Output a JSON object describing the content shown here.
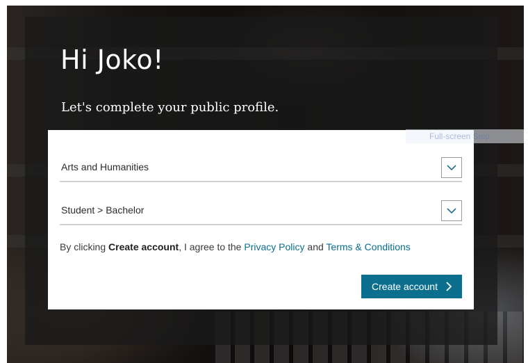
{
  "greeting": "Hi Joko!",
  "subtitle": "Let's complete your public profile.",
  "fields": {
    "subject_area": {
      "value": "Arts and Humanities",
      "icon": "chevron-down-icon"
    },
    "position": {
      "value": "Student > Bachelor",
      "icon": "chevron-down-icon"
    }
  },
  "terms": {
    "prefix": "By clicking",
    "strong": "Create account",
    "middle": ", I agree to the",
    "privacy_link": "Privacy Policy",
    "and": "and",
    "terms_link": "Terms & Conditions"
  },
  "create_button": {
    "label": "Create account",
    "icon": "chevron-right-icon"
  },
  "snip_overlay": "Full-screen Snip",
  "colors": {
    "accent": "#0c6f8e",
    "link": "#0a6e8c",
    "overlay": "#191919"
  }
}
